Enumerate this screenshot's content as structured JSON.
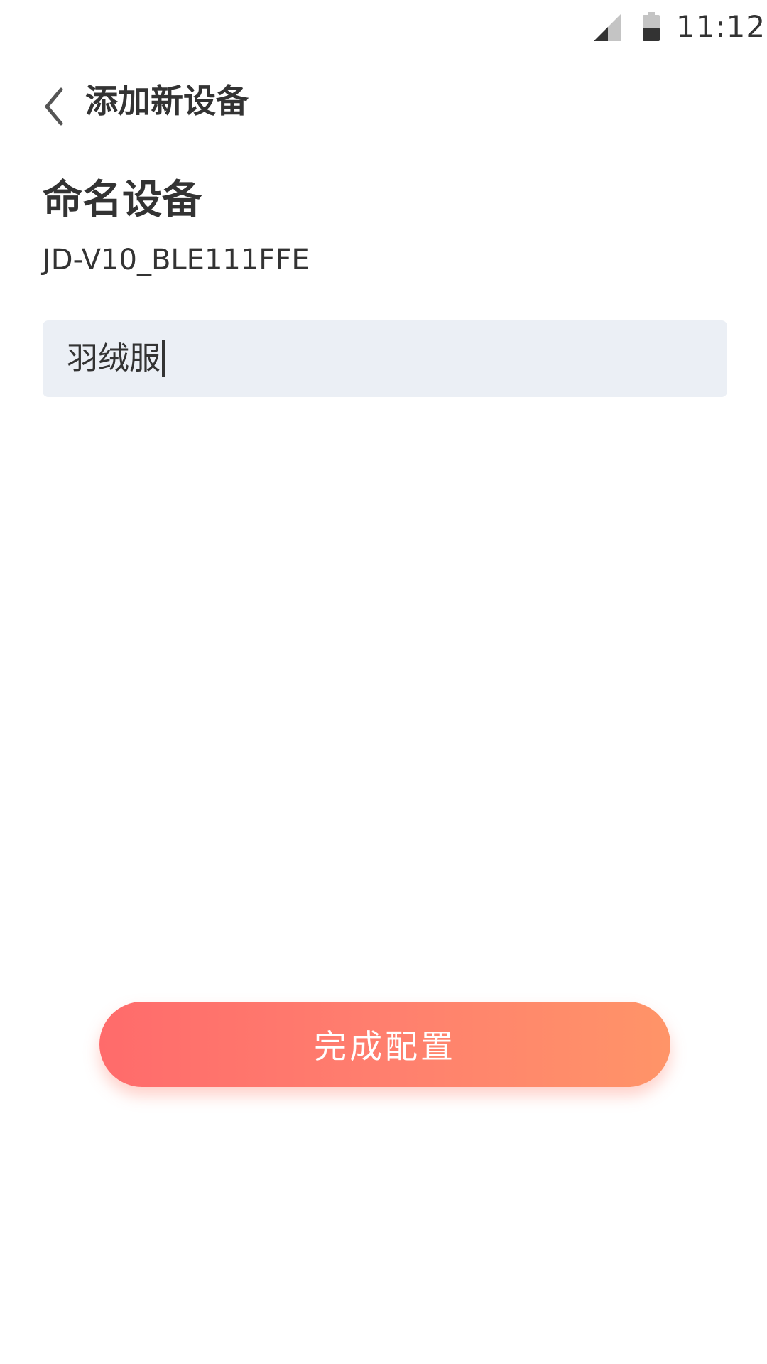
{
  "status_bar": {
    "time": "11:12",
    "signal_icon": "cellular-signal-icon",
    "battery_icon": "battery-icon"
  },
  "header": {
    "back_icon": "chevron-left-icon",
    "title": "添加新设备"
  },
  "main": {
    "section_title": "命名设备",
    "device_id": "JD-V10_BLE111FFE",
    "name_input": {
      "value": "羽绒服"
    },
    "finish_button_label": "完成配置"
  },
  "colors": {
    "background": "#ffffff",
    "text_primary": "#333333",
    "input_background": "#ebeff5",
    "button_gradient_start": "#ff6b6b",
    "button_gradient_end": "#ff9468",
    "button_text": "#ffffff"
  }
}
